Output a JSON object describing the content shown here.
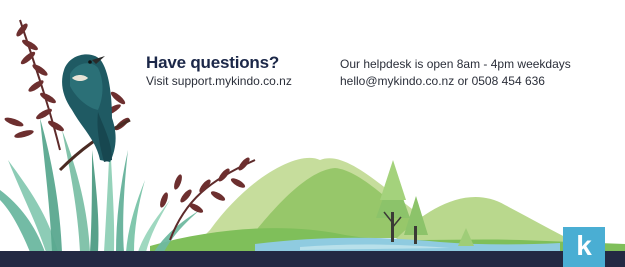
{
  "heading": {
    "title": "Have questions?",
    "support_line": "Visit support.mykindo.co.nz"
  },
  "helpdesk": {
    "hours": "Our helpdesk is open 8am - 4pm weekdays",
    "contact": "hello@mykindo.co.nz or 0508 454 636"
  },
  "logo": {
    "letter": "k",
    "color": "#4aaed3"
  },
  "colors": {
    "footer_bar": "#232943",
    "title_text": "#1b2748",
    "body_text": "#2b2f3a"
  }
}
